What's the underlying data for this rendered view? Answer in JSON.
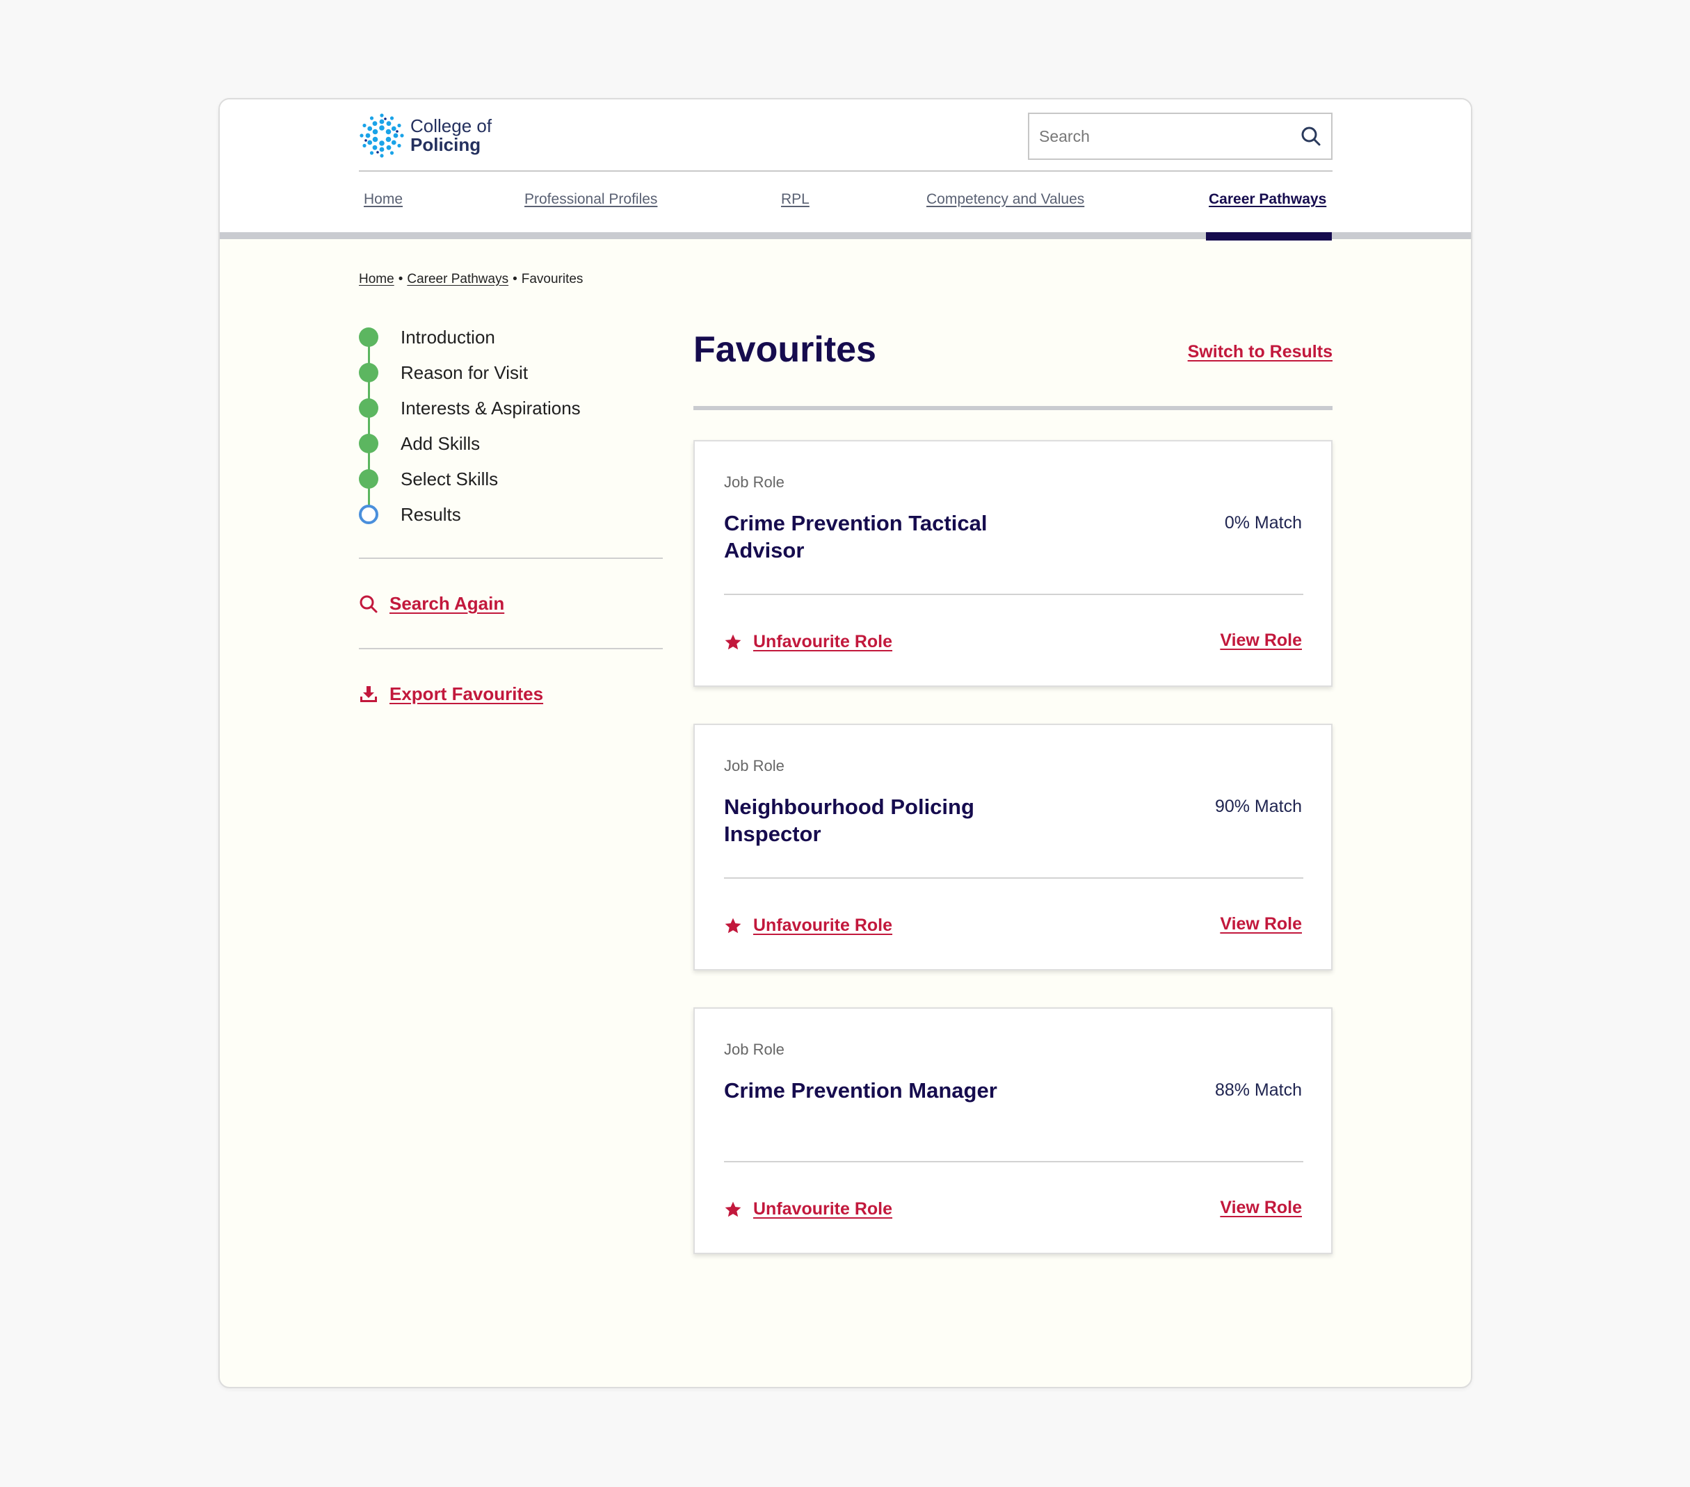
{
  "brand": {
    "line1": "College of",
    "line2": "Policing",
    "accent_color": "#1aa3e8"
  },
  "search": {
    "placeholder": "Search",
    "value": ""
  },
  "nav": {
    "items": [
      {
        "label": "Home",
        "active": false
      },
      {
        "label": "Professional Profiles",
        "active": false
      },
      {
        "label": "RPL",
        "active": false
      },
      {
        "label": "Competency and Values",
        "active": false
      },
      {
        "label": "Career Pathways",
        "active": true
      }
    ],
    "active_color": "#160c4e"
  },
  "breadcrumb": {
    "items": [
      "Home",
      "Career Pathways"
    ],
    "current": "Favourites"
  },
  "steps": [
    {
      "label": "Introduction",
      "state": "complete"
    },
    {
      "label": "Reason for Visit",
      "state": "complete"
    },
    {
      "label": "Interests & Aspirations",
      "state": "complete"
    },
    {
      "label": "Add Skills",
      "state": "complete"
    },
    {
      "label": "Select Skills",
      "state": "complete"
    },
    {
      "label": "Results",
      "state": "current"
    }
  ],
  "sidebar_actions": {
    "search_again": "Search Again",
    "export": "Export Favourites"
  },
  "main": {
    "title": "Favourites",
    "switch_link": "Switch to Results"
  },
  "cards": [
    {
      "kicker": "Job Role",
      "title": "Crime Prevention Tactical Advisor",
      "match": "0% Match",
      "unfavourite": "Unfavourite Role",
      "view": "View Role"
    },
    {
      "kicker": "Job Role",
      "title": "Neighbourhood Policing Inspector",
      "match": "90% Match",
      "unfavourite": "Unfavourite Role",
      "view": "View Role"
    },
    {
      "kicker": "Job Role",
      "title": "Crime Prevention Manager",
      "match": "88% Match",
      "unfavourite": "Unfavourite Role",
      "view": "View Role"
    }
  ],
  "colors": {
    "link_red": "#c2183c",
    "navy": "#160c4e",
    "step_complete": "#5cb660",
    "step_current": "#4a8fdc"
  }
}
